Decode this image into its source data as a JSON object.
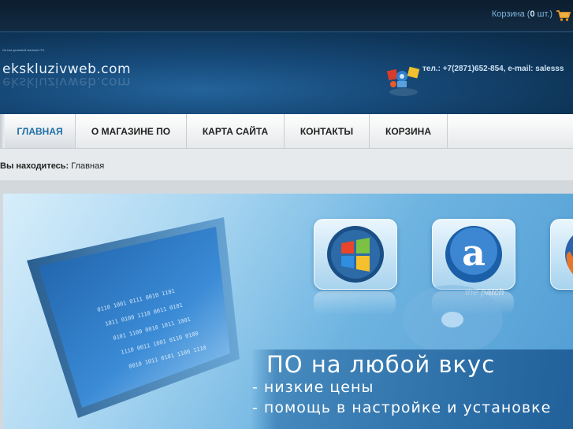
{
  "topbar": {
    "cart_prefix": "Корзина (",
    "cart_count": "0",
    "cart_suffix": " шт.)",
    "cart_icon": "cart-icon"
  },
  "header": {
    "tagline": "Оптом дешевый магазин ПО",
    "logo_text": "ekskluzivweb.com",
    "contacts": "тел.: +7(2871)652-854, e-mail: salesss"
  },
  "nav": {
    "items": [
      {
        "label": "ГЛАВНАЯ",
        "active": true
      },
      {
        "label": "О МАГАЗИНЕ ПО",
        "active": false
      },
      {
        "label": "КАРТА САЙТА",
        "active": false
      },
      {
        "label": "КОНТАКТЫ",
        "active": false
      },
      {
        "label": "КОРЗИНА",
        "active": false
      }
    ]
  },
  "breadcrumb": {
    "prefix": "Вы находитесь:",
    "current": "Главная"
  },
  "banner": {
    "slogan_title": "ПО на любой вкус",
    "slogan_line1": "- низкие цены",
    "slogan_line2": "- помощь в настройке и установке",
    "tile_icons": [
      "windows-icon",
      "avast-icon",
      "firefox-icon"
    ],
    "tile_caption": "the patch"
  },
  "colors": {
    "accent": "#1f6ea6",
    "header_dark": "#0e3457"
  }
}
